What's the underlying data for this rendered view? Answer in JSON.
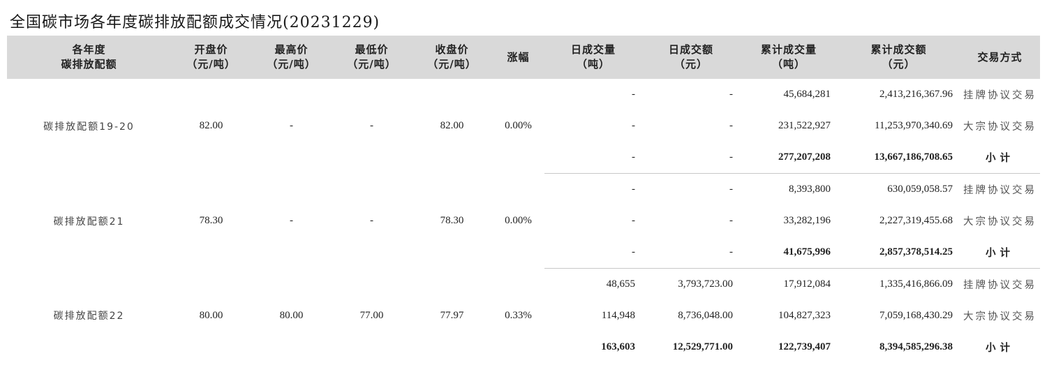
{
  "title": "全国碳市场各年度碳排放配额成交情况(20231229)",
  "headers": [
    [
      "各年度",
      "碳排放配额"
    ],
    [
      "开盘价",
      "（元/吨）"
    ],
    [
      "最高价",
      "（元/吨）"
    ],
    [
      "最低价",
      "（元/吨）"
    ],
    [
      "收盘价",
      "（元/吨）"
    ],
    [
      "涨幅",
      ""
    ],
    [
      "日成交量",
      "（吨）"
    ],
    [
      "日成交额",
      "（元）"
    ],
    [
      "累计成交量",
      "（吨）"
    ],
    [
      "累计成交额",
      "（元）"
    ],
    [
      "交易方式",
      ""
    ]
  ],
  "groups": [
    {
      "name": "碳排放配额19-20",
      "open": "82.00",
      "high": "-",
      "low": "-",
      "close": "82.00",
      "change": "0.00%",
      "rows": [
        {
          "vol": "-",
          "amt": "-",
          "cum_vol": "45,684,281",
          "cum_amt": "2,413,216,367.96",
          "mode": "挂牌协议交易"
        },
        {
          "vol": "-",
          "amt": "-",
          "cum_vol": "231,522,927",
          "cum_amt": "11,253,970,340.69",
          "mode": "大宗协议交易"
        },
        {
          "vol": "-",
          "amt": "-",
          "cum_vol": "277,207,208",
          "cum_amt": "13,667,186,708.65",
          "mode": "小计"
        }
      ]
    },
    {
      "name": "碳排放配额21",
      "open": "78.30",
      "high": "-",
      "low": "-",
      "close": "78.30",
      "change": "0.00%",
      "rows": [
        {
          "vol": "-",
          "amt": "-",
          "cum_vol": "8,393,800",
          "cum_amt": "630,059,058.57",
          "mode": "挂牌协议交易"
        },
        {
          "vol": "-",
          "amt": "-",
          "cum_vol": "33,282,196",
          "cum_amt": "2,227,319,455.68",
          "mode": "大宗协议交易"
        },
        {
          "vol": "-",
          "amt": "-",
          "cum_vol": "41,675,996",
          "cum_amt": "2,857,378,514.25",
          "mode": "小计"
        }
      ]
    },
    {
      "name": "碳排放配额22",
      "open": "80.00",
      "high": "80.00",
      "low": "77.00",
      "close": "77.97",
      "change": "0.33%",
      "rows": [
        {
          "vol": "48,655",
          "amt": "3,793,723.00",
          "cum_vol": "17,912,084",
          "cum_amt": "1,335,416,866.09",
          "mode": "挂牌协议交易"
        },
        {
          "vol": "114,948",
          "amt": "8,736,048.00",
          "cum_vol": "104,827,323",
          "cum_amt": "7,059,168,430.29",
          "mode": "大宗协议交易"
        },
        {
          "vol": "163,603",
          "amt": "12,529,771.00",
          "cum_vol": "122,739,407",
          "cum_amt": "8,394,585,296.38",
          "mode": "小计"
        }
      ]
    }
  ]
}
